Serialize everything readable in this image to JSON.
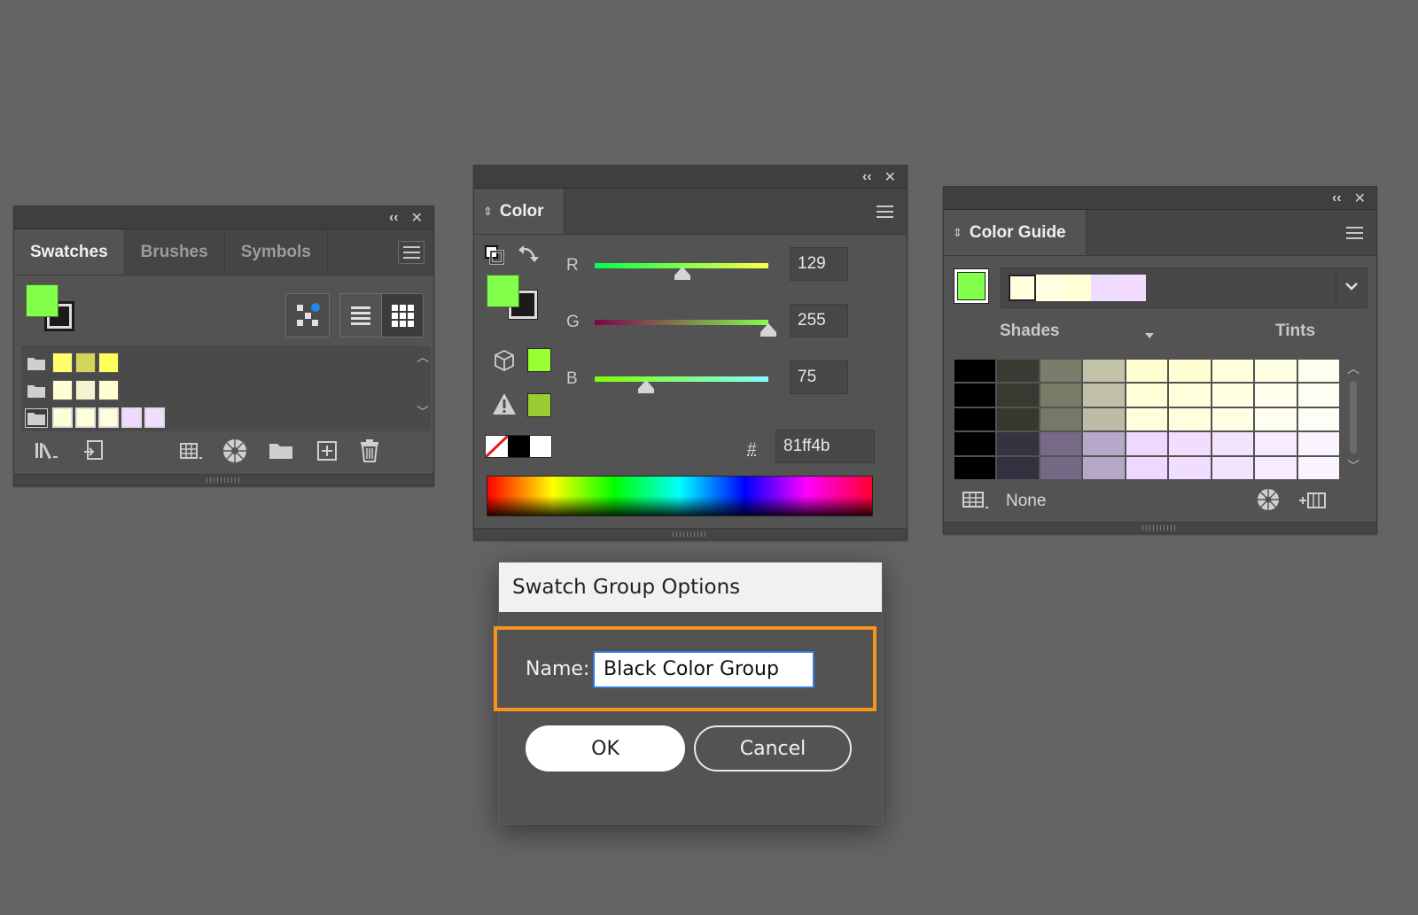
{
  "panel_controls": {
    "collapse": "‹‹",
    "close": "✕"
  },
  "swatches_panel": {
    "tabs": [
      "Swatches",
      "Brushes",
      "Symbols"
    ],
    "fill_color": "#81ff4b",
    "groups": [
      {
        "swatches": [
          "#ffff6e",
          "#d4d45a",
          "#ffff5a"
        ]
      },
      {
        "swatches": [
          "#ffffd6",
          "#f5f2d0",
          "#ffffd2"
        ]
      },
      {
        "selected": true,
        "swatches": [
          "#ffffd6",
          "#ffffda",
          "#ffffe0",
          "#f0d9ff",
          "#f2dcff"
        ]
      }
    ]
  },
  "color_panel": {
    "tab": "Color",
    "fill_color": "#81ff4b",
    "channels": [
      {
        "label": "R",
        "value": "129",
        "level": 0.506
      },
      {
        "label": "G",
        "value": "255",
        "level": 1.0
      },
      {
        "label": "B",
        "value": "75",
        "level": 0.294
      }
    ],
    "hex_label": "#",
    "hex_value": "81ff4b",
    "web_safe_color": "#99ff33",
    "gamut_color": "#99cc33"
  },
  "color_guide_panel": {
    "tab": "Color Guide",
    "base_color": "#81ff4b",
    "harmony_colors": [
      "#ffffdd",
      "#ffffe0",
      "#ffffd8",
      "#f0dcff",
      "#f2dcff"
    ],
    "shades_label": "Shades",
    "tints_label": "Tints",
    "grid": [
      [
        "#000000",
        "#3b3b33",
        "#7c7c6a",
        "#c3c3aa",
        "#ffffd2",
        "#ffffd4",
        "#ffffdc",
        "#ffffe6",
        "#fffff0"
      ],
      [
        "#000000",
        "#393931",
        "#7a7a68",
        "#c0c0a8",
        "#ffffd8",
        "#ffffdb",
        "#ffffe2",
        "#ffffec",
        "#fffff4"
      ],
      [
        "#000000",
        "#38382f",
        "#787866",
        "#bdbda5",
        "#ffffdd",
        "#ffffe0",
        "#ffffe6",
        "#fffff0",
        "#fffff8"
      ],
      [
        "#000000",
        "#373240",
        "#776a86",
        "#b6a8c8",
        "#efd8ff",
        "#f2ddff",
        "#f4e3ff",
        "#f7ebff",
        "#faf4ff"
      ],
      [
        "#000000",
        "#353040",
        "#756a86",
        "#b4a8c6",
        "#eed8ff",
        "#f1ddff",
        "#f3e3ff",
        "#f6ebff",
        "#f9f4ff"
      ]
    ],
    "footer_label": "None"
  },
  "dialog": {
    "title": "Swatch Group Options",
    "name_label": "Name:",
    "name_value": "Black Color Group",
    "ok_label": "OK",
    "cancel_label": "Cancel",
    "highlight_color": "#f7931e"
  }
}
